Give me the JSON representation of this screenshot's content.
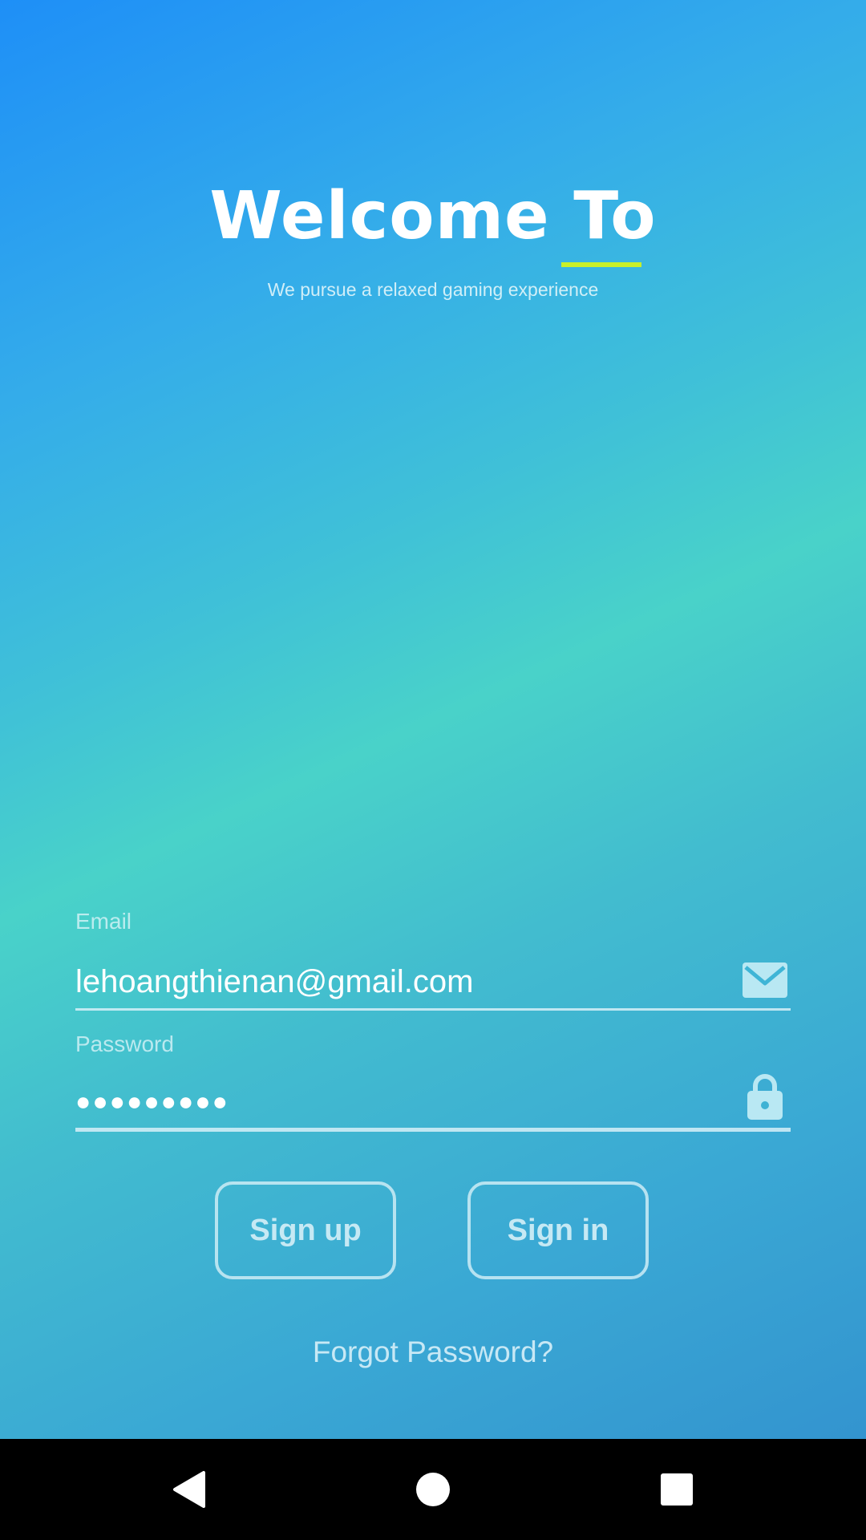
{
  "header": {
    "title": "Welcome To",
    "tagline": "We pursue a relaxed gaming experience",
    "accent_color": "#c8f02a"
  },
  "form": {
    "email": {
      "label": "Email",
      "value": "lehoangthienan@gmail.com",
      "icon": "envelope-icon"
    },
    "password": {
      "label": "Password",
      "value": "●●●●●●●●●",
      "icon": "lock-icon"
    }
  },
  "actions": {
    "sign_up_label": "Sign up",
    "sign_in_label": "Sign in",
    "forgot_label": "Forgot Password?"
  },
  "navbar": {
    "back_icon": "back-triangle-icon",
    "home_icon": "home-circle-icon",
    "recents_icon": "recents-square-icon"
  }
}
